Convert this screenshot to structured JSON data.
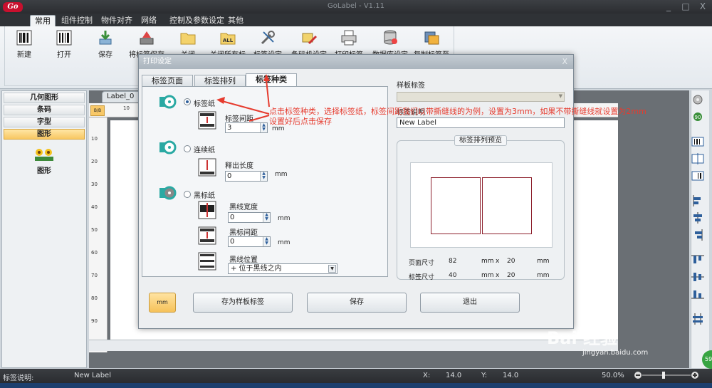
{
  "app": {
    "window_title": "GoLabel - V1.11",
    "logo_text": "Go",
    "window_controls": [
      "_",
      "□",
      "X"
    ]
  },
  "menu": {
    "tabs": [
      {
        "label": "常用"
      },
      {
        "label": "组件控制"
      },
      {
        "label": "物件对齐"
      },
      {
        "label": "网络"
      },
      {
        "label": "控制及参数设定"
      },
      {
        "label": "其他"
      }
    ]
  },
  "ribbon": {
    "buttons": [
      {
        "label": "新建",
        "icon": "barcode-new-icon"
      },
      {
        "label": "打开",
        "icon": "barcode-open-icon"
      },
      {
        "label": "保存",
        "icon": "save-icon"
      },
      {
        "label": "将标签保存",
        "icon": "save-label-icon"
      },
      {
        "label": "关闭",
        "icon": "folder-icon"
      },
      {
        "label": "关闭所有标",
        "icon": "close-all-icon",
        "badge": "ALL"
      },
      {
        "label": "标签设定",
        "icon": "tools-icon"
      },
      {
        "label": "条码机设定",
        "icon": "printer-settings-icon"
      },
      {
        "label": "打印标签",
        "icon": "printer-icon"
      },
      {
        "label": "数据库设定",
        "icon": "database-icon"
      },
      {
        "label": "复制标签至",
        "icon": "copy-label-icon"
      }
    ]
  },
  "left_panel": {
    "items": [
      {
        "label": "几何图形"
      },
      {
        "label": "条码"
      },
      {
        "label": "字型"
      },
      {
        "label": "图形"
      }
    ],
    "shape_label": "图形"
  },
  "canvas": {
    "doc_tab": "Label_0",
    "corner_label": "B/B",
    "top_ticks": [
      "10"
    ],
    "left_ticks": [
      "10",
      "20",
      "30",
      "40",
      "50",
      "60",
      "70",
      "80",
      "90",
      "100"
    ]
  },
  "dialog": {
    "title": "打印设定",
    "close": "X",
    "tabs": [
      {
        "label": "标签页面"
      },
      {
        "label": "标签排列"
      },
      {
        "label": "标签种类"
      }
    ],
    "paper_types": {
      "label_paper": "标签纸",
      "continuous_paper": "连续纸",
      "black_mark_paper": "黑标纸"
    },
    "fields": {
      "label_gap": {
        "label": "标签间距",
        "value": "3",
        "unit": "mm"
      },
      "release_length": {
        "label": "释出长度",
        "value": "0",
        "unit": "mm"
      },
      "black_width": {
        "label": "黑线宽度",
        "value": "0",
        "unit": "mm"
      },
      "black_gap": {
        "label": "黑标间距",
        "value": "0",
        "unit": "mm"
      },
      "black_position": {
        "label": "黑线位置",
        "value": "+ 位于黑线之内"
      }
    },
    "right": {
      "template_label": "样板标签",
      "description_label": "标签说明",
      "description_value": "New Label",
      "preview_title": "标签排列预览",
      "page_size_label": "页面尺寸",
      "page_w": "82",
      "page_h": "20",
      "label_size_label": "标签尺寸",
      "label_w": "40",
      "label_h": "20",
      "unit": "mm",
      "times": "x"
    },
    "buttons": {
      "unit": "mm",
      "save_template": "存为样板标签",
      "save": "保存",
      "exit": "退出"
    }
  },
  "annotation": {
    "line1": "点击标签种类，选择标签纸，标签间距我们以带撕缝线的为例，设置为3mm，如果不带撕缝线就设置为2mm",
    "line2": "设置好后点击保存"
  },
  "statusbar": {
    "desc_label": "标签说明:",
    "desc_value": "New Label",
    "x_label": "X:",
    "x_value": "14.0",
    "y_label": "Y:",
    "y_value": "14.0",
    "zoom": "50.0%"
  },
  "watermark": {
    "text": "Bai 经验",
    "url": "jingyan.baidu.com"
  },
  "badge": "59",
  "colors": {
    "accent_red": "#e63b2e",
    "label_outline": "#8d1f2c",
    "highlight": "#f8c762"
  }
}
